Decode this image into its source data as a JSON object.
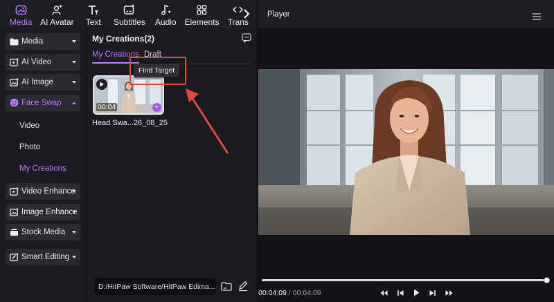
{
  "toolbar": {
    "items": [
      {
        "label": "Media",
        "icon": "media-icon",
        "active": true
      },
      {
        "label": "AI Avatar",
        "icon": "ai-avatar-icon"
      },
      {
        "label": "Text",
        "icon": "text-icon"
      },
      {
        "label": "Subtitles",
        "icon": "subtitles-icon"
      },
      {
        "label": "Audio",
        "icon": "audio-icon"
      },
      {
        "label": "Elements",
        "icon": "elements-icon"
      },
      {
        "label": "Trans",
        "icon": "transitions-icon"
      }
    ]
  },
  "sidebar": {
    "items": [
      {
        "label": "Media",
        "icon": "folder-icon"
      },
      {
        "label": "AI Video",
        "icon": "ai-video-icon"
      },
      {
        "label": "AI Image",
        "icon": "ai-image-icon"
      },
      {
        "label": "Face Swap",
        "icon": "face-swap-icon"
      },
      {
        "label": "Video Enhance",
        "icon": "video-enhance-icon"
      },
      {
        "label": "Image Enhance",
        "icon": "image-enhance-icon"
      },
      {
        "label": "Stock Media",
        "icon": "stock-media-icon"
      },
      {
        "label": "Smart Editing",
        "icon": "smart-editing-icon"
      }
    ],
    "face_swap_sub": [
      "Video",
      "Photo",
      "My Creations"
    ]
  },
  "panel": {
    "title": "My Creations(2)",
    "tabs": [
      "My Creations",
      "Draft"
    ],
    "tooltip": "Find Target",
    "thumb": {
      "duration": "00:04",
      "name": "Head Swa...26_08_25"
    },
    "path": "D:/HitPaw Software/HitPaw Edima..."
  },
  "player": {
    "title": "Player",
    "current_time": "00:04:09",
    "separator": " / ",
    "total_time": "00:04:09",
    "progress": 1.0
  },
  "colors": {
    "accent": "#b877ff",
    "annotation": "#e34a3b"
  }
}
